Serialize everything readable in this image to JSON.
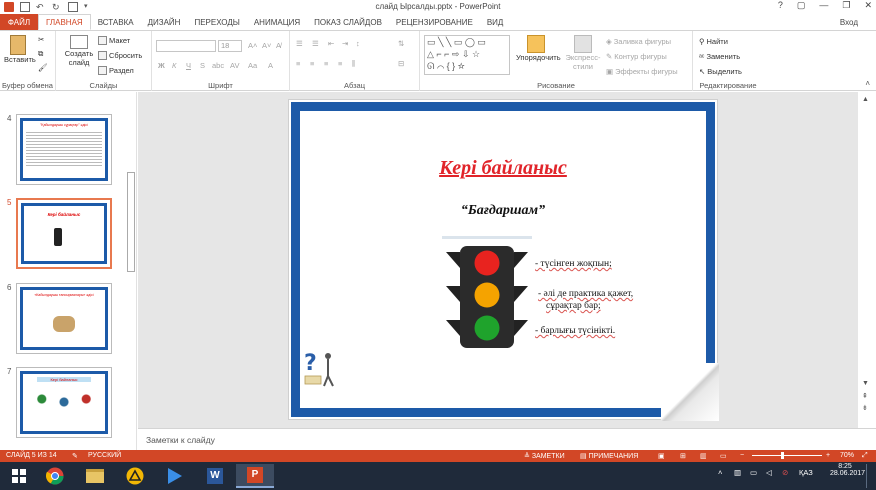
{
  "app": {
    "window_title": "слайд Ырсалды.pptx - PowerPoint",
    "window_controls": [
      "?",
      "▢",
      "—",
      "❐",
      "✕"
    ],
    "signin": "Вход"
  },
  "tabs": [
    "ФАЙЛ",
    "ГЛАВНАЯ",
    "ВСТАВКА",
    "ДИЗАЙН",
    "ПЕРЕХОДЫ",
    "АНИМАЦИЯ",
    "ПОКАЗ СЛАЙДОВ",
    "РЕЦЕНЗИРОВАНИЕ",
    "ВИД"
  ],
  "ribbon": {
    "clipboard": {
      "paste": "Вставить",
      "label": "Буфер обмена"
    },
    "slides": {
      "create": "Создать",
      "create2": "слайд",
      "layout": "Макет",
      "reset": "Сбросить",
      "section": "Раздел",
      "label": "Слайды"
    },
    "font": {
      "size": "18",
      "label": "Шрифт"
    },
    "paragraph": {
      "label": "Абзац"
    },
    "drawing": {
      "arrange": "Упорядочить",
      "express": "Экспресс-",
      "express2": "стили",
      "fill": "Заливка фигуры",
      "outline": "Контур фигуры",
      "effects": "Эффекты фигуры",
      "label": "Рисование"
    },
    "editing": {
      "find": "Найти",
      "replace": "Заменить",
      "select": "Выделить",
      "label": "Редактирование"
    }
  },
  "thumbnails": [
    {
      "num": "4",
      "title": "\"Қабылдаушы сұрақтар\" әдісі"
    },
    {
      "num": "5",
      "title": "Кері байланыс",
      "selected": true
    },
    {
      "num": "6",
      "title": "«Кабылдаушы тапсырмалары» әдісі"
    },
    {
      "num": "7",
      "title": "Кері байланыс"
    }
  ],
  "slide": {
    "title": "Кері байланыс",
    "subtitle": "“Бағдаршам”",
    "bullet1": "- түсінген жоқпын;",
    "bullet2a": "- әлі де практика қажет,",
    "bullet2b": "сұрақтар бар;",
    "bullet3": "- барлығы түсінікті.",
    "colors": {
      "frame": "#1d5aa8",
      "title": "#e1242a",
      "red": "#e8231f",
      "yellow": "#f5a300",
      "green": "#1fa32c"
    }
  },
  "notes_placeholder": "Заметки к слайду",
  "status": {
    "slide_count": "СЛАЙД 5 ИЗ 14",
    "language": "РУССКИЙ",
    "notes": "ЗАМЕТКИ",
    "comments": "ПРИМЕЧАНИЯ",
    "zoom": "70%"
  },
  "taskbar": {
    "lang": "ҚАЗ",
    "time": "8:25",
    "date": "28.06.2017"
  }
}
